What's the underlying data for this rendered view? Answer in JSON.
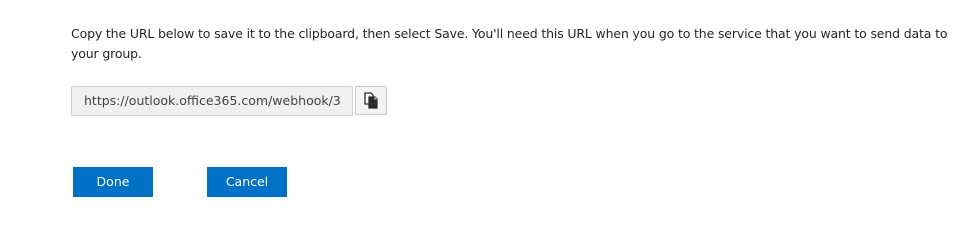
{
  "instructions": "Copy the URL below to save it to the clipboard, then select Save. You'll need this URL when you go to the service that you want to send data to your group.",
  "webhook": {
    "url_value": "https://outlook.office365.com/webhook/3",
    "copy_icon": "copy-icon"
  },
  "actions": {
    "done_label": "Done",
    "cancel_label": "Cancel"
  },
  "colors": {
    "primary_button": "#0072c6",
    "field_background": "#f0f0f0"
  }
}
